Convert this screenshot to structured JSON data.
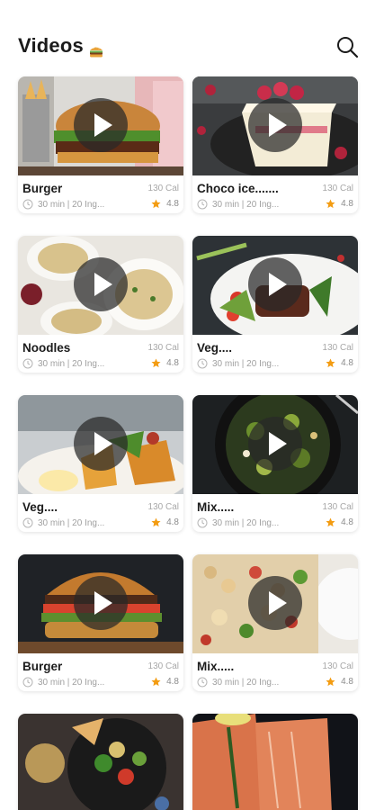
{
  "header": {
    "title": "Videos",
    "title_emoji_icon": "burger-emoji-icon",
    "search_icon": "search-icon"
  },
  "accent_color": "#f39c12",
  "videos": [
    {
      "name": "Burger",
      "calories": "130 Cal",
      "meta": "30 min | 20 Ing...",
      "rating": "4.8"
    },
    {
      "name": "Choco ice.......",
      "calories": "130 Cal",
      "meta": "30 min | 20 Ing...",
      "rating": "4.8"
    },
    {
      "name": "Noodles",
      "calories": "130 Cal",
      "meta": "30 min | 20 Ing...",
      "rating": "4.8"
    },
    {
      "name": "Veg....",
      "calories": "130 Cal",
      "meta": "30 min | 20 Ing...",
      "rating": "4.8"
    },
    {
      "name": "Veg....",
      "calories": "130 Cal",
      "meta": "30 min | 20 Ing...",
      "rating": "4.8"
    },
    {
      "name": "Mix.....",
      "calories": "130 Cal",
      "meta": "30 min | 20 Ing...",
      "rating": "4.8"
    },
    {
      "name": "Burger",
      "calories": "130 Cal",
      "meta": "30 min | 20 Ing...",
      "rating": "4.8"
    },
    {
      "name": "Mix.....",
      "calories": "130 Cal",
      "meta": "30 min | 20 Ing...",
      "rating": "4.8"
    }
  ]
}
